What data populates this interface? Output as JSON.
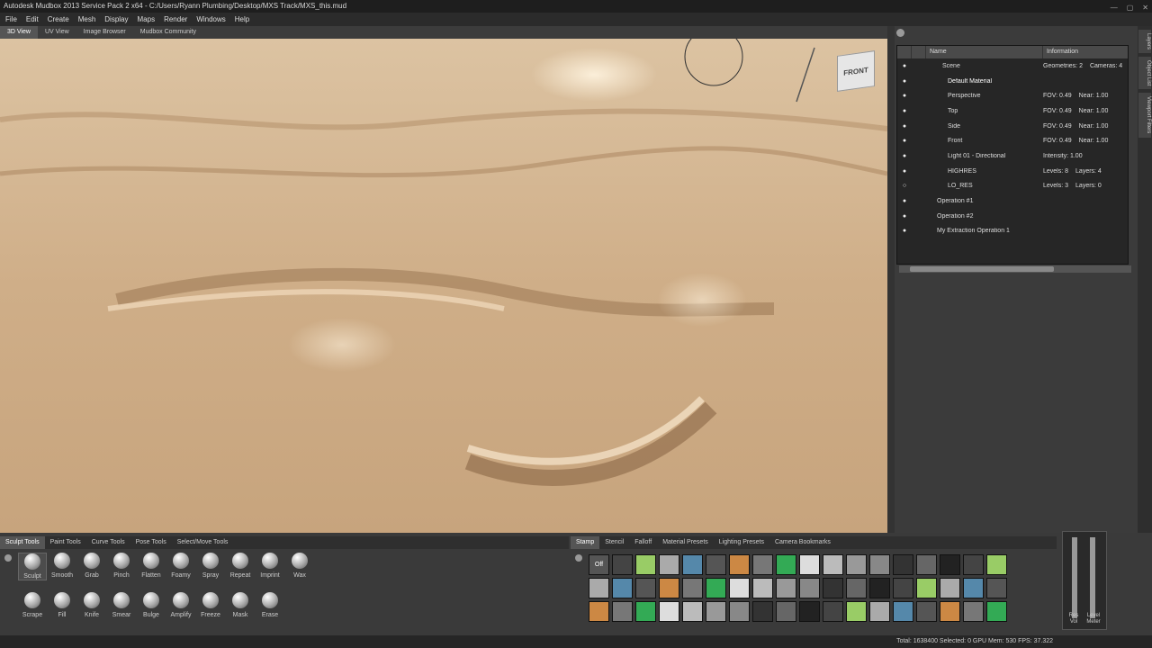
{
  "window": {
    "title": "Autodesk Mudbox 2013 Service Pack 2 x64 - C:/Users/Ryann Plumbing/Desktop/MXS Track/MXS_this.mud",
    "controls": [
      "—",
      "▢",
      "✕"
    ]
  },
  "menu": [
    "File",
    "Edit",
    "Create",
    "Mesh",
    "Display",
    "Maps",
    "Render",
    "Windows",
    "Help"
  ],
  "view_tabs": [
    "3D View",
    "UV View",
    "Image Browser",
    "Mudbox Community"
  ],
  "viewport": {
    "view_cube_label": "FRONT"
  },
  "outliner": {
    "headers": {
      "name": "Name",
      "info": "Information"
    },
    "rows": [
      {
        "name": "Scene",
        "info1": "Geometries: 2",
        "info2": "Cameras: 4"
      },
      {
        "name": "Default Material",
        "info1": "",
        "info2": ""
      },
      {
        "name": "Perspective",
        "info1": "FOV: 0.49",
        "info2": "Near: 1.00"
      },
      {
        "name": "Top",
        "info1": "FOV: 0.49",
        "info2": "Near: 1.00"
      },
      {
        "name": "Side",
        "info1": "FOV: 0.49",
        "info2": "Near: 1.00"
      },
      {
        "name": "Front",
        "info1": "FOV: 0.49",
        "info2": "Near: 1.00"
      },
      {
        "name": "Light 01 - Directional",
        "info1": "Intensity: 1.00",
        "info2": ""
      },
      {
        "name": "HIGHRES",
        "info1": "Levels: 8",
        "info2": "Layers: 4"
      },
      {
        "name": "LO_RES",
        "info1": "Levels: 3",
        "info2": "Layers: 0"
      },
      {
        "name": "Operation #1",
        "info1": "",
        "info2": ""
      },
      {
        "name": "Operation #2",
        "info1": "",
        "info2": ""
      },
      {
        "name": "My Extraction Operation 1",
        "info1": "",
        "info2": ""
      }
    ]
  },
  "side_tabs": [
    "Layers",
    "Object List",
    "Viewport Filters"
  ],
  "tool_tabs": [
    "Sculpt Tools",
    "Paint Tools",
    "Curve Tools",
    "Pose Tools",
    "Select/Move Tools"
  ],
  "tools_row1": [
    "Sculpt",
    "Smooth",
    "Grab",
    "Pinch",
    "Flatten",
    "Foamy",
    "Spray",
    "Repeat",
    "Imprint",
    "Wax"
  ],
  "tools_row2": [
    "Scrape",
    "Fill",
    "Knife",
    "Smear",
    "Bulge",
    "Amplify",
    "Freeze",
    "Mask",
    "Erase"
  ],
  "stamp_tabs": [
    "Stamp",
    "Stencil",
    "Falloff",
    "Material Presets",
    "Lighting Presets",
    "Camera Bookmarks"
  ],
  "stamp_off_label": "Off",
  "sliders": {
    "left_label": "Res Vol",
    "right_label": "Level Meter"
  },
  "status": "Total: 1638400   Selected: 0   GPU Mem: 530   FPS: 37.322"
}
